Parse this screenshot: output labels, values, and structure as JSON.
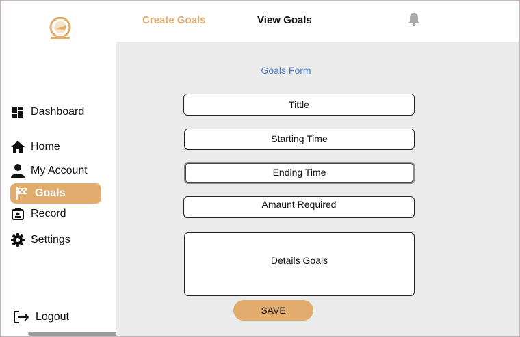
{
  "header": {
    "tabs": [
      {
        "label": "Create Goals",
        "active": true
      },
      {
        "label": "View Goals",
        "active": false
      }
    ],
    "notification_icon": "bell-icon"
  },
  "sidebar": {
    "logo_icon": "brand-logo",
    "items": [
      {
        "label": "Dashboard",
        "icon": "dashboard-icon"
      },
      {
        "label": "Home",
        "icon": "home-icon"
      },
      {
        "label": "My Account",
        "icon": "user-icon"
      },
      {
        "label": "Goals",
        "icon": "flag-icon",
        "active": true
      },
      {
        "label": "Record",
        "icon": "record-icon"
      },
      {
        "label": "Settings",
        "icon": "gear-icon"
      },
      {
        "label": "Logout",
        "icon": "logout-icon"
      }
    ]
  },
  "form": {
    "title": "Goals Form",
    "fields": {
      "title": "Tittle",
      "start": "Starting Time",
      "end": "Ending Time",
      "amount": "Amaunt Required",
      "details": "Details Goals"
    },
    "save_label": "SAVE"
  },
  "colors": {
    "accent": "#e1ac6c",
    "form_title": "#4a7ac8",
    "main_bg": "#ebebeb"
  }
}
